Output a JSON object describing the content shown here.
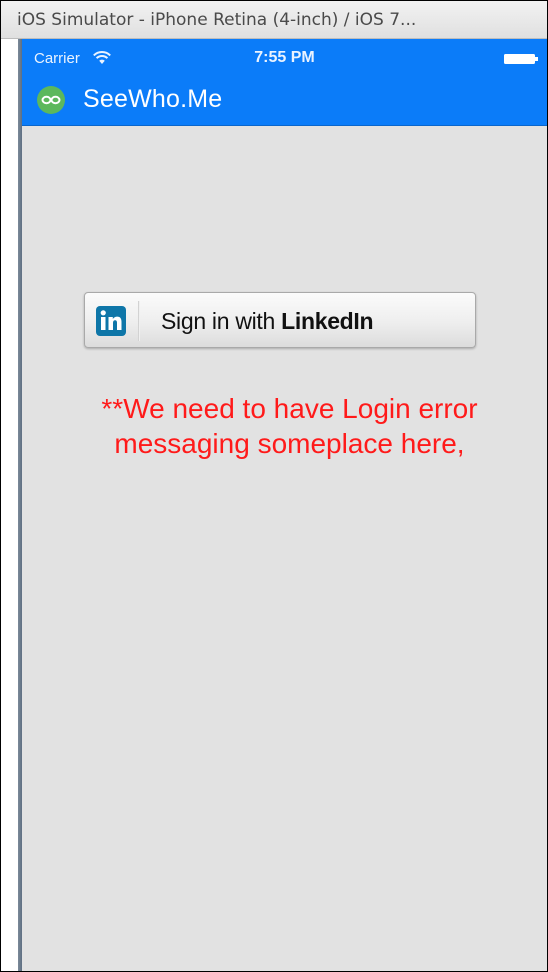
{
  "simulator": {
    "window_title": "iOS Simulator - iPhone Retina (4-inch) / iOS 7..."
  },
  "status_bar": {
    "carrier": "Carrier",
    "time": "7:55 PM",
    "background_color": "#0b7cf9"
  },
  "nav_bar": {
    "title": "SeeWho.Me",
    "logo_icon": "infinity-logo-icon",
    "logo_color": "#5cb85c"
  },
  "login": {
    "button_prefix": "Sign in with ",
    "button_brand": "LinkedIn",
    "button_icon": "linkedin-icon",
    "brand_color": "#0e76a8"
  },
  "error": {
    "line1": "**We need to have Login error",
    "line2": "messaging someplace here,",
    "color": "#ff1a1a"
  }
}
